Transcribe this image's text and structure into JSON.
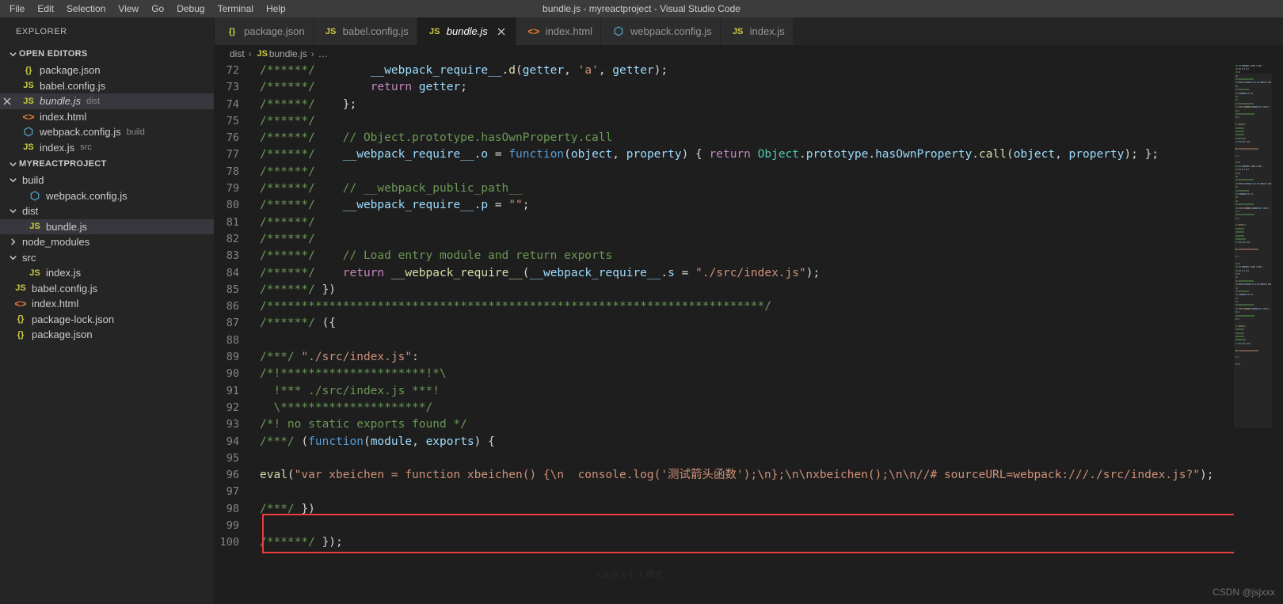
{
  "window": {
    "title": "bundle.js - myreactproject - Visual Studio Code"
  },
  "menubar": {
    "items": [
      {
        "label": "File"
      },
      {
        "label": "Edit"
      },
      {
        "label": "Selection"
      },
      {
        "label": "View"
      },
      {
        "label": "Go"
      },
      {
        "label": "Debug"
      },
      {
        "label": "Terminal"
      },
      {
        "label": "Help"
      }
    ]
  },
  "sidebar": {
    "title": "EXPLORER",
    "open_editors": {
      "header": "OPEN EDITORS",
      "items": [
        {
          "icon": "json-braces-icon",
          "name": "package.json",
          "desc": "",
          "active": false
        },
        {
          "icon": "js-icon",
          "name": "babel.config.js",
          "desc": "",
          "active": false
        },
        {
          "icon": "js-icon",
          "name": "bundle.js",
          "desc": "dist",
          "active": true
        },
        {
          "icon": "html-icon",
          "name": "index.html",
          "desc": "",
          "active": false
        },
        {
          "icon": "webpack-icon",
          "name": "webpack.config.js",
          "desc": "build",
          "active": false
        },
        {
          "icon": "js-icon",
          "name": "index.js",
          "desc": "src",
          "active": false
        }
      ]
    },
    "project": {
      "header": "MYREACTPROJECT",
      "items": [
        {
          "icon": "folder-open-icon",
          "name": "build",
          "depth": 1,
          "kind": "folder",
          "expanded": true
        },
        {
          "icon": "webpack-icon",
          "name": "webpack.config.js",
          "depth": 2,
          "kind": "file"
        },
        {
          "icon": "folder-open-icon",
          "name": "dist",
          "depth": 1,
          "kind": "folder",
          "expanded": true
        },
        {
          "icon": "js-icon",
          "name": "bundle.js",
          "depth": 2,
          "kind": "file",
          "selected": true
        },
        {
          "icon": "folder-collapsed-icon",
          "name": "node_modules",
          "depth": 1,
          "kind": "folder",
          "expanded": false
        },
        {
          "icon": "folder-open-icon",
          "name": "src",
          "depth": 1,
          "kind": "folder",
          "expanded": true
        },
        {
          "icon": "js-icon",
          "name": "index.js",
          "depth": 2,
          "kind": "file"
        },
        {
          "icon": "js-icon",
          "name": "babel.config.js",
          "depth": 1,
          "kind": "file"
        },
        {
          "icon": "html-icon",
          "name": "index.html",
          "depth": 1,
          "kind": "file"
        },
        {
          "icon": "json-braces-icon",
          "name": "package-lock.json",
          "depth": 1,
          "kind": "file"
        },
        {
          "icon": "json-braces-icon",
          "name": "package.json",
          "depth": 1,
          "kind": "file"
        }
      ]
    }
  },
  "tabs": [
    {
      "icon": "json-braces-icon",
      "label": "package.json",
      "active": false,
      "closable": false
    },
    {
      "icon": "js-icon",
      "label": "babel.config.js",
      "active": false,
      "closable": false
    },
    {
      "icon": "js-icon",
      "label": "bundle.js",
      "active": true,
      "closable": true
    },
    {
      "icon": "html-icon",
      "label": "index.html",
      "active": false,
      "closable": false
    },
    {
      "icon": "webpack-icon",
      "label": "webpack.config.js",
      "active": false,
      "closable": false
    },
    {
      "icon": "js-icon",
      "label": "index.js",
      "active": false,
      "closable": false
    }
  ],
  "breadcrumb": {
    "items": [
      "dist",
      "bundle.js",
      "…"
    ],
    "file_icon": "js-icon",
    "separator": "›"
  },
  "code": {
    "first_line_number": 72,
    "lines": [
      {
        "n": 72,
        "tokens": [
          {
            "t": "/******/",
            "c": "c-com"
          },
          {
            "t": "        ",
            "c": "c-plain"
          },
          {
            "t": "__webpack_require__",
            "c": "c-var"
          },
          {
            "t": ".",
            "c": "c-plain"
          },
          {
            "t": "d",
            "c": "c-meth"
          },
          {
            "t": "(",
            "c": "c-plain"
          },
          {
            "t": "getter",
            "c": "c-var"
          },
          {
            "t": ", ",
            "c": "c-plain"
          },
          {
            "t": "'a'",
            "c": "c-str"
          },
          {
            "t": ", ",
            "c": "c-plain"
          },
          {
            "t": "getter",
            "c": "c-var"
          },
          {
            "t": ");",
            "c": "c-plain"
          }
        ]
      },
      {
        "n": 73,
        "tokens": [
          {
            "t": "/******/",
            "c": "c-com"
          },
          {
            "t": "        ",
            "c": "c-plain"
          },
          {
            "t": "return",
            "c": "c-kw"
          },
          {
            "t": " ",
            "c": "c-plain"
          },
          {
            "t": "getter",
            "c": "c-var"
          },
          {
            "t": ";",
            "c": "c-plain"
          }
        ]
      },
      {
        "n": 74,
        "tokens": [
          {
            "t": "/******/",
            "c": "c-com"
          },
          {
            "t": "    };",
            "c": "c-plain"
          }
        ]
      },
      {
        "n": 75,
        "tokens": [
          {
            "t": "/******/",
            "c": "c-com"
          }
        ]
      },
      {
        "n": 76,
        "tokens": [
          {
            "t": "/******/",
            "c": "c-com"
          },
          {
            "t": "    ",
            "c": "c-plain"
          },
          {
            "t": "// Object.prototype.hasOwnProperty.call",
            "c": "c-com"
          }
        ]
      },
      {
        "n": 77,
        "tokens": [
          {
            "t": "/******/",
            "c": "c-com"
          },
          {
            "t": "    ",
            "c": "c-plain"
          },
          {
            "t": "__webpack_require__",
            "c": "c-var"
          },
          {
            "t": ".",
            "c": "c-plain"
          },
          {
            "t": "o",
            "c": "c-var"
          },
          {
            "t": " = ",
            "c": "c-plain"
          },
          {
            "t": "function",
            "c": "c-fn"
          },
          {
            "t": "(",
            "c": "c-plain"
          },
          {
            "t": "object",
            "c": "c-var"
          },
          {
            "t": ", ",
            "c": "c-plain"
          },
          {
            "t": "property",
            "c": "c-var"
          },
          {
            "t": ") { ",
            "c": "c-plain"
          },
          {
            "t": "return",
            "c": "c-kw"
          },
          {
            "t": " ",
            "c": "c-plain"
          },
          {
            "t": "Object",
            "c": "c-cls"
          },
          {
            "t": ".",
            "c": "c-plain"
          },
          {
            "t": "prototype",
            "c": "c-var"
          },
          {
            "t": ".",
            "c": "c-plain"
          },
          {
            "t": "hasOwnProperty",
            "c": "c-var"
          },
          {
            "t": ".",
            "c": "c-plain"
          },
          {
            "t": "call",
            "c": "c-meth"
          },
          {
            "t": "(",
            "c": "c-plain"
          },
          {
            "t": "object",
            "c": "c-var"
          },
          {
            "t": ", ",
            "c": "c-plain"
          },
          {
            "t": "property",
            "c": "c-var"
          },
          {
            "t": "); };",
            "c": "c-plain"
          }
        ]
      },
      {
        "n": 78,
        "tokens": [
          {
            "t": "/******/",
            "c": "c-com"
          }
        ]
      },
      {
        "n": 79,
        "tokens": [
          {
            "t": "/******/",
            "c": "c-com"
          },
          {
            "t": "    ",
            "c": "c-plain"
          },
          {
            "t": "// __webpack_public_path__",
            "c": "c-com"
          }
        ]
      },
      {
        "n": 80,
        "tokens": [
          {
            "t": "/******/",
            "c": "c-com"
          },
          {
            "t": "    ",
            "c": "c-plain"
          },
          {
            "t": "__webpack_require__",
            "c": "c-var"
          },
          {
            "t": ".",
            "c": "c-plain"
          },
          {
            "t": "p",
            "c": "c-var"
          },
          {
            "t": " = ",
            "c": "c-plain"
          },
          {
            "t": "\"\"",
            "c": "c-str"
          },
          {
            "t": ";",
            "c": "c-plain"
          }
        ]
      },
      {
        "n": 81,
        "tokens": [
          {
            "t": "/******/",
            "c": "c-com"
          }
        ]
      },
      {
        "n": 82,
        "tokens": [
          {
            "t": "/******/",
            "c": "c-com"
          }
        ]
      },
      {
        "n": 83,
        "tokens": [
          {
            "t": "/******/",
            "c": "c-com"
          },
          {
            "t": "    ",
            "c": "c-plain"
          },
          {
            "t": "// Load entry module and return exports",
            "c": "c-com"
          }
        ]
      },
      {
        "n": 84,
        "tokens": [
          {
            "t": "/******/",
            "c": "c-com"
          },
          {
            "t": "    ",
            "c": "c-plain"
          },
          {
            "t": "return",
            "c": "c-kw"
          },
          {
            "t": " ",
            "c": "c-plain"
          },
          {
            "t": "__webpack_require__",
            "c": "c-meth"
          },
          {
            "t": "(",
            "c": "c-plain"
          },
          {
            "t": "__webpack_require__",
            "c": "c-var"
          },
          {
            "t": ".",
            "c": "c-plain"
          },
          {
            "t": "s",
            "c": "c-var"
          },
          {
            "t": " = ",
            "c": "c-plain"
          },
          {
            "t": "\"./src/index.js\"",
            "c": "c-str"
          },
          {
            "t": ");",
            "c": "c-plain"
          }
        ]
      },
      {
        "n": 85,
        "tokens": [
          {
            "t": "/******/",
            "c": "c-com"
          },
          {
            "t": " })",
            "c": "c-plain"
          }
        ]
      },
      {
        "n": 86,
        "tokens": [
          {
            "t": "/************************************************************************/",
            "c": "c-com"
          }
        ]
      },
      {
        "n": 87,
        "tokens": [
          {
            "t": "/******/",
            "c": "c-com"
          },
          {
            "t": " ({",
            "c": "c-plain"
          }
        ]
      },
      {
        "n": 88,
        "tokens": []
      },
      {
        "n": 89,
        "tokens": [
          {
            "t": "/***/",
            "c": "c-com"
          },
          {
            "t": " ",
            "c": "c-plain"
          },
          {
            "t": "\"./src/index.js\"",
            "c": "c-str"
          },
          {
            "t": ":",
            "c": "c-plain"
          }
        ]
      },
      {
        "n": 90,
        "tokens": [
          {
            "t": "/*!*********************!*\\",
            "c": "c-com"
          }
        ]
      },
      {
        "n": 91,
        "tokens": [
          {
            "t": "  !*** ./src/index.js ***!",
            "c": "c-com"
          }
        ]
      },
      {
        "n": 92,
        "tokens": [
          {
            "t": "  \\*********************/",
            "c": "c-com"
          }
        ]
      },
      {
        "n": 93,
        "tokens": [
          {
            "t": "/*! no static exports found */",
            "c": "c-com"
          }
        ]
      },
      {
        "n": 94,
        "tokens": [
          {
            "t": "/***/",
            "c": "c-com"
          },
          {
            "t": " (",
            "c": "c-plain"
          },
          {
            "t": "function",
            "c": "c-fn"
          },
          {
            "t": "(",
            "c": "c-plain"
          },
          {
            "t": "module",
            "c": "c-var"
          },
          {
            "t": ", ",
            "c": "c-plain"
          },
          {
            "t": "exports",
            "c": "c-var"
          },
          {
            "t": ") {",
            "c": "c-plain"
          }
        ]
      },
      {
        "n": 95,
        "tokens": []
      },
      {
        "n": 96,
        "tokens": [
          {
            "t": "eval",
            "c": "c-meth"
          },
          {
            "t": "(",
            "c": "c-plain"
          },
          {
            "t": "\"var xbeichen = function xbeichen() {\\n  console.log('测试箭头函数');\\n};\\n\\nxbeichen();\\n\\n//# sourceURL=webpack:///./src/index.js?\"",
            "c": "c-str"
          },
          {
            "t": ");",
            "c": "c-plain"
          }
        ]
      },
      {
        "n": 97,
        "tokens": []
      },
      {
        "n": 98,
        "tokens": [
          {
            "t": "/***/",
            "c": "c-com"
          },
          {
            "t": " })",
            "c": "c-plain"
          }
        ]
      },
      {
        "n": 99,
        "tokens": []
      },
      {
        "n": 100,
        "tokens": [
          {
            "t": "/******/",
            "c": "c-com"
          },
          {
            "t": " });",
            "c": "c-plain"
          }
        ]
      }
    ],
    "annotation_box": {
      "color": "#ef3b3b",
      "covers_lines": [
        95,
        96,
        97
      ]
    }
  },
  "watermarks": {
    "center": "X北辰X个人博客",
    "corner": "CSDN @jsjxxx"
  },
  "colors": {
    "titlebar_bg": "#3c3c3c",
    "sidebar_bg": "#252526",
    "editor_bg": "#1e1e1e",
    "tab_active_bg": "#1e1e1e",
    "tab_inactive_bg": "#2d2d2d",
    "selection_bg": "#37373d",
    "accent_red": "#ef3b3b",
    "line_number": "#858585"
  }
}
